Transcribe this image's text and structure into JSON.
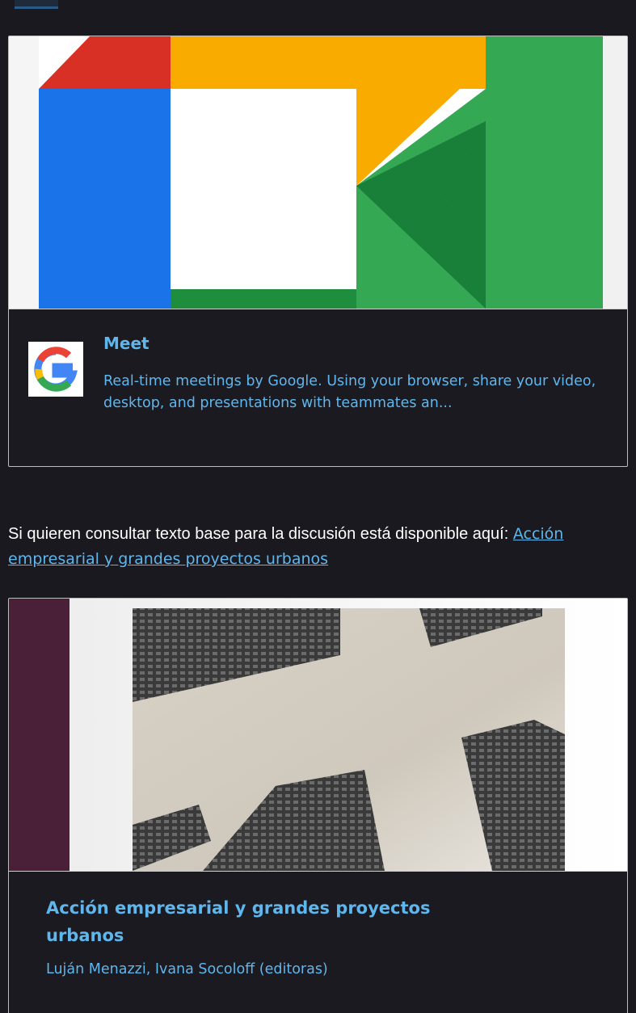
{
  "meet_card": {
    "title": "Meet",
    "description": "Real-time meetings by Google. Using your browser, share your video, desktop, and presentations with teammates an...",
    "favicon": "google-g-logo",
    "hero_image": "google-meet-logo"
  },
  "paragraph": {
    "text": "Si quieren consultar texto base para la discusión está disponible aquí: ",
    "link_text": "Acción empresarial y grandes proyectos urbanos"
  },
  "book_card": {
    "title": "Acción empresarial y grandes proyectos urbanos",
    "authors": "Luján Menazzi, Ivana Socoloff (editoras)",
    "hero_image": "skyscrapers-cover"
  },
  "colors": {
    "background": "#1a191f",
    "link": "#5fb6ec",
    "text": "#ffffff",
    "sidebar_maroon": "#4a1f38"
  }
}
